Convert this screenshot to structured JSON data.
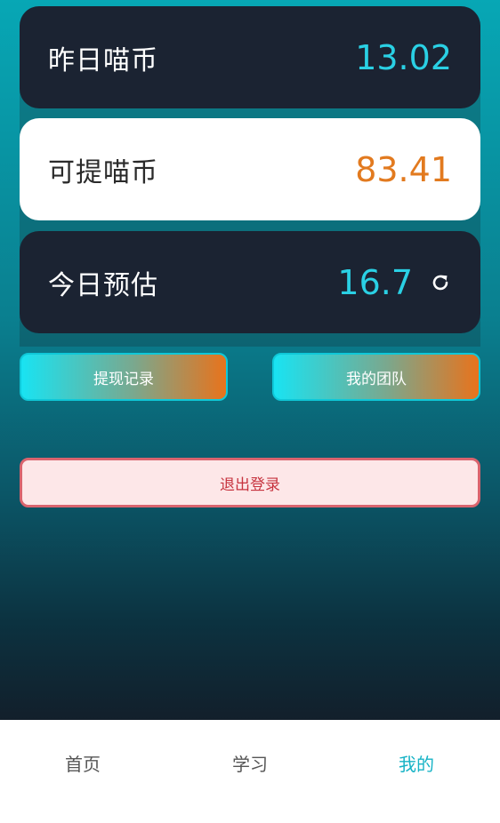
{
  "stats": {
    "yesterday": {
      "label": "昨日喵币",
      "value": "13.02"
    },
    "withdrawable": {
      "label": "可提喵币",
      "value": "83.41"
    },
    "today_estimate": {
      "label": "今日预估",
      "value": "16.7"
    }
  },
  "actions": {
    "withdraw_records": "提现记录",
    "my_team": "我的团队",
    "logout": "退出登录"
  },
  "tabbar": {
    "home": "首页",
    "study": "学习",
    "mine": "我的",
    "active": "mine"
  },
  "colors": {
    "accent_cyan": "#2ad0e4",
    "accent_orange": "#e27a1f",
    "card_dark": "#1b2332",
    "logout_text": "#c7343f",
    "tab_active": "#17b3c6"
  },
  "icons": {
    "refresh": "refresh-icon"
  }
}
